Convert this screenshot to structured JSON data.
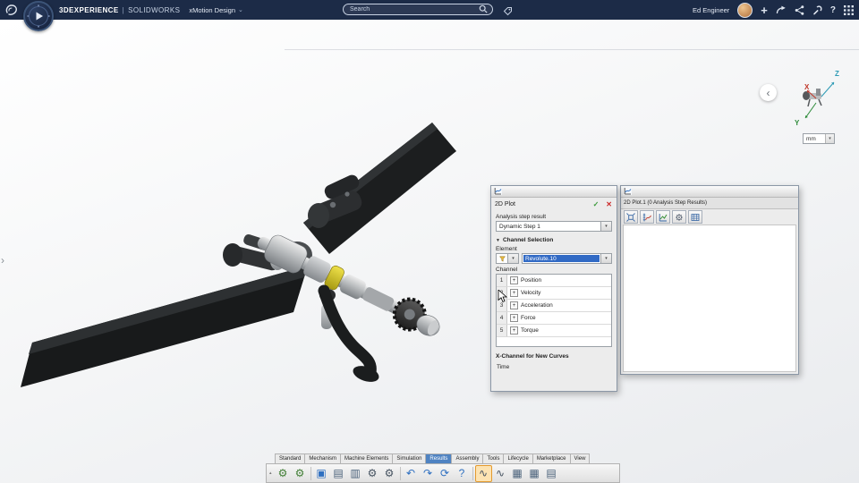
{
  "colors": {
    "topbar_bg": "#1c2b47",
    "accent_blue": "#2e6fc0",
    "selection_blue": "#316ac5",
    "active_tab_blue": "#4f83c2",
    "ok_green": "#3a9a3a",
    "cancel_red": "#cc2a2a",
    "model_highlight_yellow": "#d8c31f"
  },
  "topbar": {
    "brand": "3DEXPERIENCE",
    "separator": "|",
    "app": "SOLIDWORKS",
    "workspace": "xMotion Design",
    "workspace_caret": "⌄",
    "search_placeholder": "Search",
    "user_name": "Ed Engineer",
    "add_glyph": "+",
    "help_glyph": "?"
  },
  "viewport": {
    "back_glyph": "‹",
    "panel_glyph": "›",
    "units": "mm",
    "axis_x": "X",
    "axis_y": "Y",
    "axis_z": "Z"
  },
  "plot_dialog": {
    "title": "2D Plot",
    "ok_glyph": "✓",
    "cancel_glyph": "✕",
    "analysis_step_label": "Analysis step result",
    "analysis_step_value": "Dynamic Step 1",
    "channel_selection_header": "Channel Selection",
    "element_label": "Element",
    "element_value": "Revolute.10",
    "channel_label": "Channel",
    "channels": [
      {
        "num": "1",
        "expander": "+",
        "label": "Position"
      },
      {
        "num": "2",
        "expander": "+",
        "label": "Velocity"
      },
      {
        "num": "3",
        "expander": "+",
        "label": "Acceleration"
      },
      {
        "num": "4",
        "expander": "+",
        "label": "Force"
      },
      {
        "num": "5",
        "expander": "+",
        "label": "Torque"
      }
    ],
    "x_channel_header": "X-Channel for New Curves",
    "x_channel_value": "Time"
  },
  "plot_window": {
    "caption": "2D Plot.1 (0 Analysis Step Results)"
  },
  "ribbon": {
    "active_tab": "Results",
    "tabs": [
      "Standard",
      "Mechanism",
      "Machine Elements",
      "Simulation",
      "Results",
      "Assembly",
      "Tools",
      "Lifecycle",
      "Marketplace",
      "View"
    ],
    "icons": [
      {
        "name": "run-simulation-icon",
        "glyph": "⚙"
      },
      {
        "name": "motion-settings-icon",
        "glyph": "⚙"
      },
      {
        "name": "save-icon",
        "glyph": "▣"
      },
      {
        "name": "copy-results-icon",
        "glyph": "▤"
      },
      {
        "name": "library-icon",
        "glyph": "▥"
      },
      {
        "name": "gear-pair-icon",
        "glyph": "⚙"
      },
      {
        "name": "mechanism-icon",
        "glyph": "⚙"
      },
      {
        "name": "undo-icon",
        "glyph": "↶"
      },
      {
        "name": "redo-icon",
        "glyph": "↷"
      },
      {
        "name": "refresh-icon",
        "glyph": "⟳"
      },
      {
        "name": "help-icon",
        "glyph": "?"
      },
      {
        "name": "plot-2d-icon",
        "glyph": "∿"
      },
      {
        "name": "plot-3d-icon",
        "glyph": "∿"
      },
      {
        "name": "results-table-icon",
        "glyph": "▦"
      },
      {
        "name": "spreadsheet-icon",
        "glyph": "▦"
      },
      {
        "name": "export-report-icon",
        "glyph": "▤"
      }
    ]
  }
}
